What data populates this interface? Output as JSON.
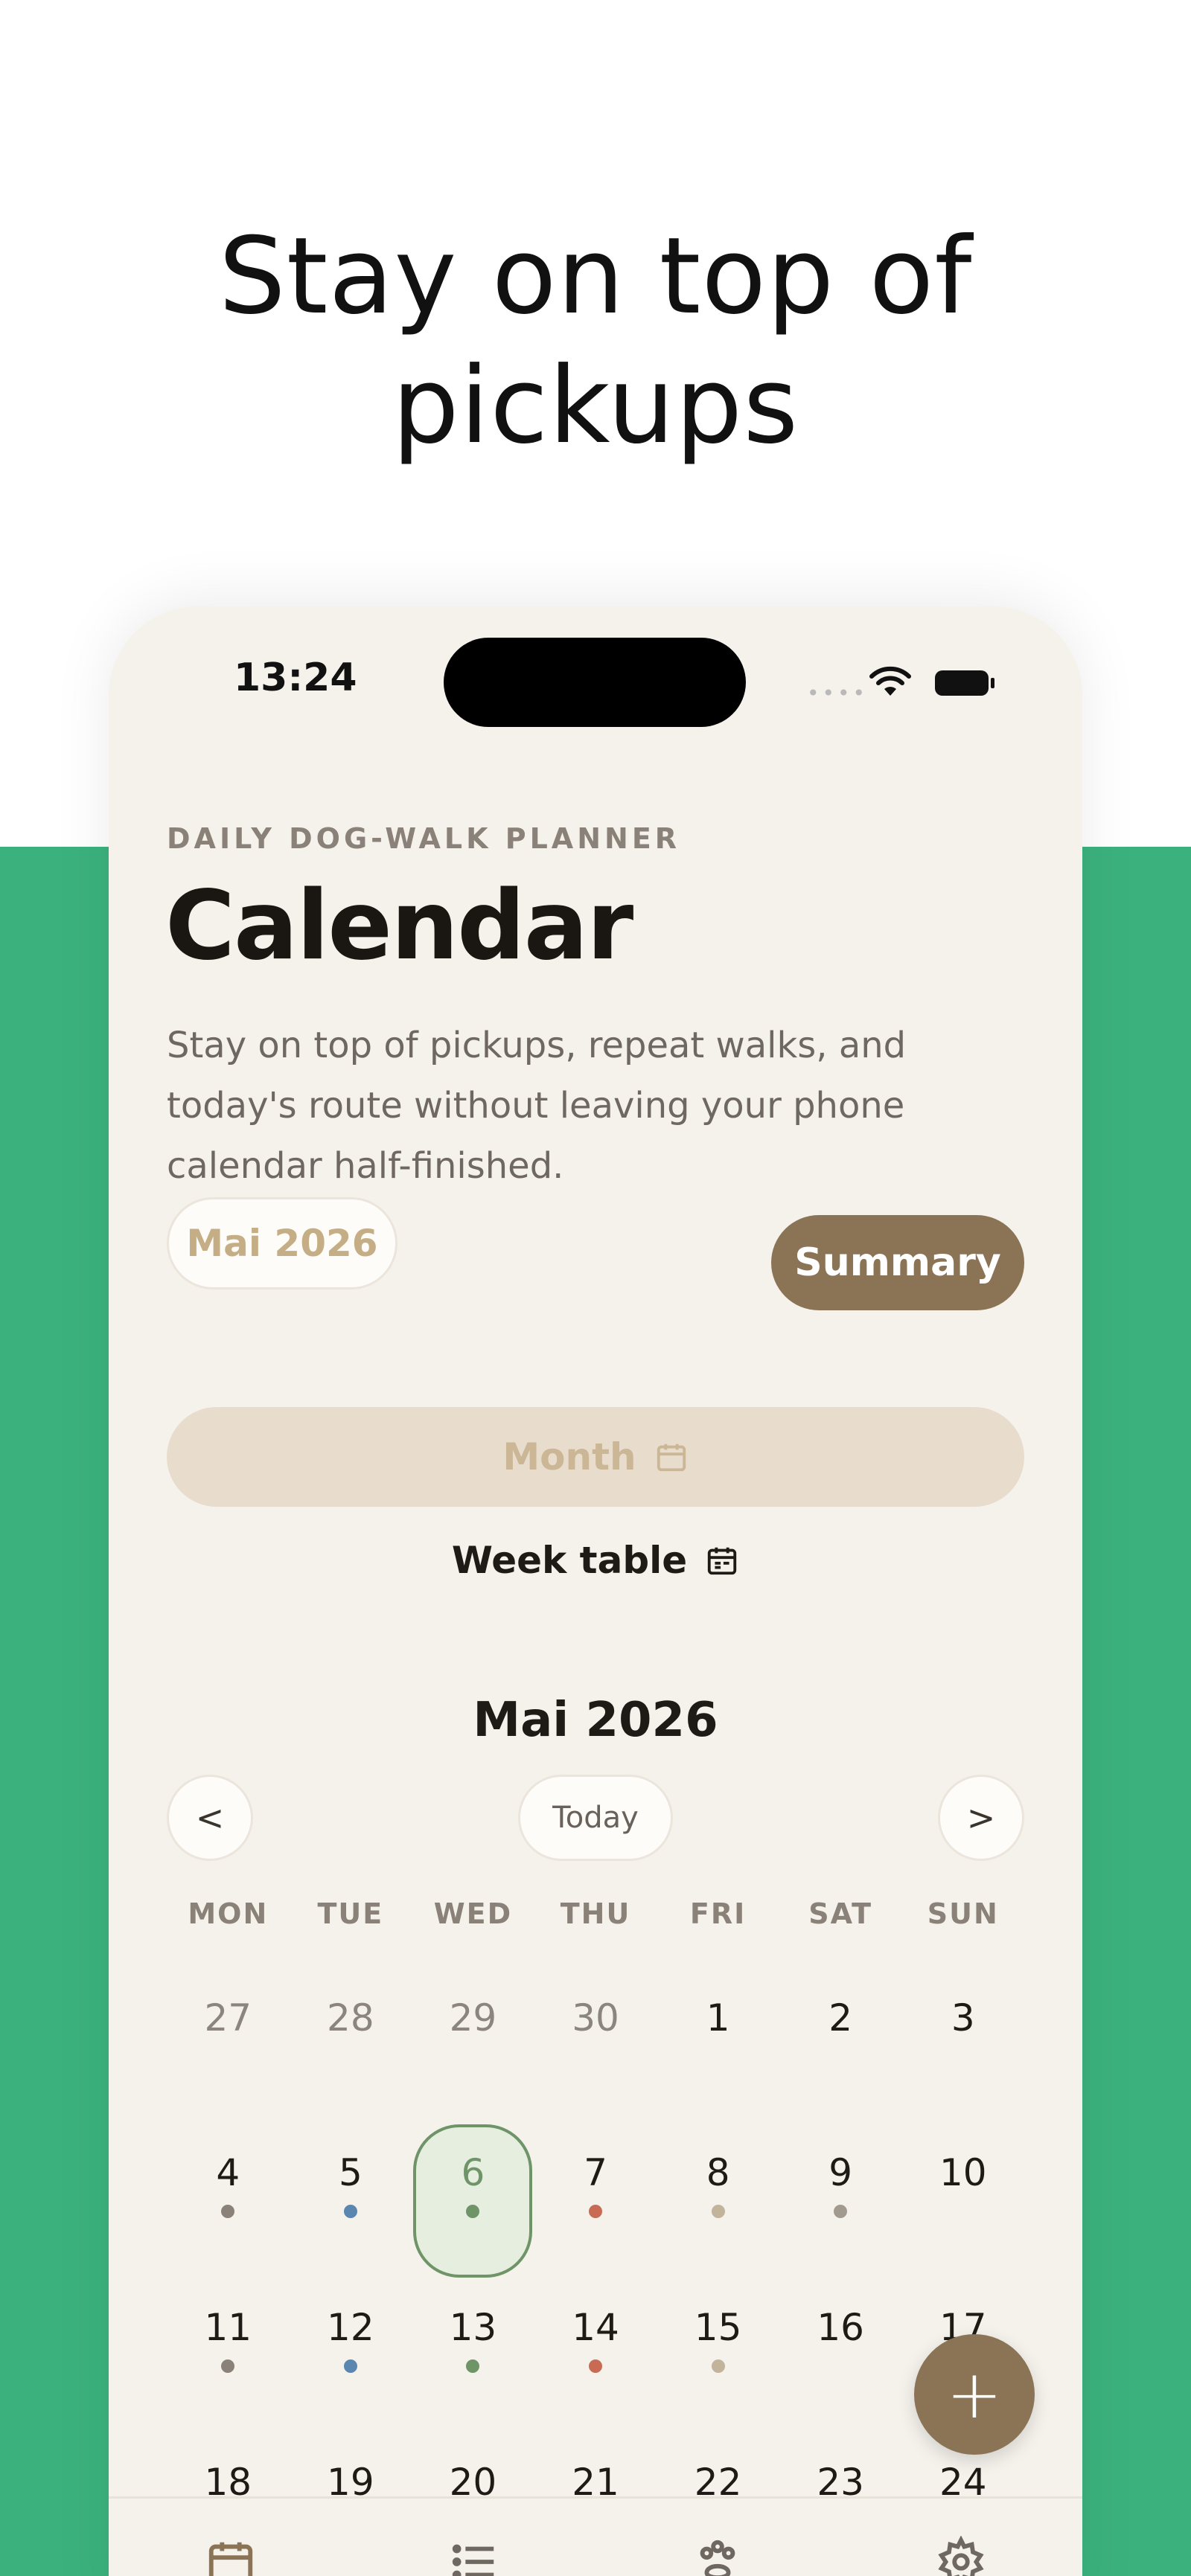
{
  "headline": "Stay on top of pickups",
  "status_bar": {
    "time": "13:24",
    "signal": "••••"
  },
  "header": {
    "eyebrow": "DAILY DOG-WALK PLANNER",
    "title": "Calendar",
    "subtitle": "Stay on top of pickups, repeat walks, and today's route without leaving your phone calendar half-finished."
  },
  "controls": {
    "month_pill": "Mai 2026",
    "summary_label": "Summary",
    "view_month_label": "Month",
    "view_week_label": "Week table"
  },
  "calendar": {
    "title": "Mai 2026",
    "prev_label": "<",
    "next_label": ">",
    "today_label": "Today",
    "weekdays": [
      "MON",
      "TUE",
      "WED",
      "THU",
      "FRI",
      "SAT",
      "SUN"
    ],
    "selected_day": "6",
    "weeks": [
      [
        {
          "day": "27",
          "muted": true,
          "dot": ""
        },
        {
          "day": "28",
          "muted": true,
          "dot": ""
        },
        {
          "day": "29",
          "muted": true,
          "dot": ""
        },
        {
          "day": "30",
          "muted": true,
          "dot": ""
        },
        {
          "day": "1",
          "muted": false,
          "dot": ""
        },
        {
          "day": "2",
          "muted": false,
          "dot": ""
        },
        {
          "day": "3",
          "muted": false,
          "dot": ""
        }
      ],
      [
        {
          "day": "4",
          "muted": false,
          "dot": "#8a8178"
        },
        {
          "day": "5",
          "muted": false,
          "dot": "#5b86b0"
        },
        {
          "day": "6",
          "muted": false,
          "dot": "#6f9468"
        },
        {
          "day": "7",
          "muted": false,
          "dot": "#c96b54"
        },
        {
          "day": "8",
          "muted": false,
          "dot": "#c2b39b"
        },
        {
          "day": "9",
          "muted": false,
          "dot": "#a39a8f"
        },
        {
          "day": "10",
          "muted": false,
          "dot": ""
        }
      ],
      [
        {
          "day": "11",
          "muted": false,
          "dot": "#8a8178"
        },
        {
          "day": "12",
          "muted": false,
          "dot": "#5b86b0"
        },
        {
          "day": "13",
          "muted": false,
          "dot": "#6f9468"
        },
        {
          "day": "14",
          "muted": false,
          "dot": "#c96b54"
        },
        {
          "day": "15",
          "muted": false,
          "dot": "#c2b39b"
        },
        {
          "day": "16",
          "muted": false,
          "dot": ""
        },
        {
          "day": "17",
          "muted": false,
          "dot": ""
        }
      ],
      [
        {
          "day": "18",
          "muted": false,
          "dot": ""
        },
        {
          "day": "19",
          "muted": false,
          "dot": ""
        },
        {
          "day": "20",
          "muted": false,
          "dot": ""
        },
        {
          "day": "21",
          "muted": false,
          "dot": ""
        },
        {
          "day": "22",
          "muted": false,
          "dot": ""
        },
        {
          "day": "23",
          "muted": false,
          "dot": ""
        },
        {
          "day": "24",
          "muted": false,
          "dot": ""
        }
      ]
    ]
  },
  "fab_label": "+",
  "tabbar": {
    "icons": [
      "calendar-icon",
      "list-icon",
      "paw-icon",
      "settings-icon"
    ]
  },
  "colors": {
    "background_green": "#3bb27e",
    "accent_brown": "#8b7355",
    "selected_green": "#6f9468"
  }
}
